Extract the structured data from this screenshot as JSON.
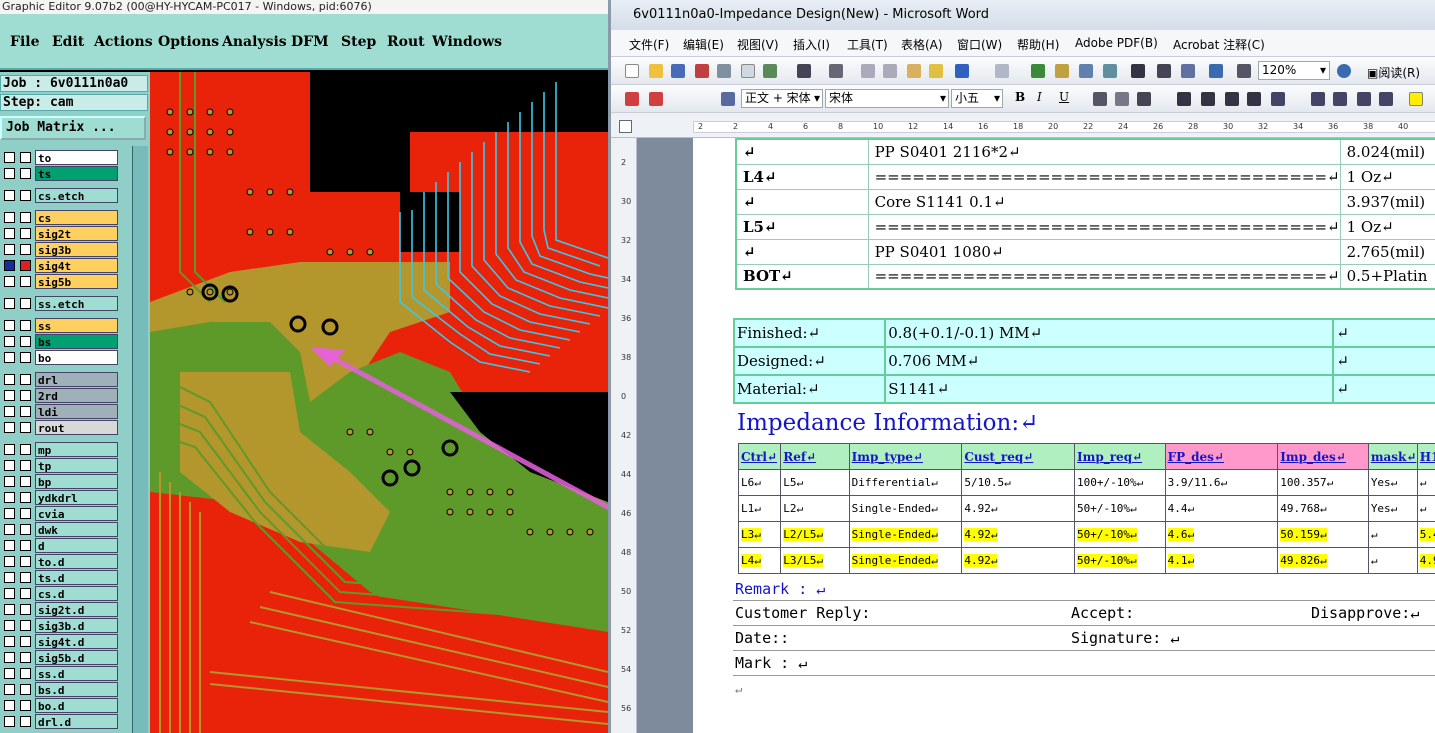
{
  "ge": {
    "title": "Graphic Editor 9.07b2 (00@HY-HYCAM-PC017 - Windows, pid:6076)",
    "menu": [
      "File",
      "Edit",
      "Actions",
      "Options",
      "Analysis",
      "DFM",
      "Step",
      "Rout",
      "Windows"
    ],
    "job": "Job : 6v0111n0a0",
    "step": "Step: cam",
    "job_matrix": "Job Matrix ...",
    "layers": [
      {
        "name": "to",
        "color": "#ffffff"
      },
      {
        "name": "ts",
        "color": "#00a070"
      },
      {
        "name": "cs.etch",
        "color": "#9fdcd2"
      },
      {
        "name": "cs",
        "color": "#ffd060"
      },
      {
        "name": "sig2t",
        "color": "#ffd060"
      },
      {
        "name": "sig3b",
        "color": "#ffd060"
      },
      {
        "name": "sig4t",
        "color": "#ffd060"
      },
      {
        "name": "sig5b",
        "color": "#ffd060"
      },
      {
        "name": "ss.etch",
        "color": "#9fdcd2"
      },
      {
        "name": "ss",
        "color": "#ffd060"
      },
      {
        "name": "bs",
        "color": "#00a070"
      },
      {
        "name": "bo",
        "color": "#ffffff"
      },
      {
        "name": "drl",
        "color": "#a0b0b8"
      },
      {
        "name": "2rd",
        "color": "#a0b0b8"
      },
      {
        "name": "ldi",
        "color": "#a0b0b8"
      },
      {
        "name": "rout",
        "color": "#d8d8d8"
      },
      {
        "name": "mp",
        "color": "#9fdcd2"
      },
      {
        "name": "tp",
        "color": "#9fdcd2"
      },
      {
        "name": "bp",
        "color": "#9fdcd2"
      },
      {
        "name": "ydkdrl",
        "color": "#9fdcd2"
      },
      {
        "name": "cvia",
        "color": "#9fdcd2"
      },
      {
        "name": "dwk",
        "color": "#9fdcd2"
      },
      {
        "name": "d",
        "color": "#9fdcd2"
      },
      {
        "name": "to.d",
        "color": "#9fdcd2"
      },
      {
        "name": "ts.d",
        "color": "#9fdcd2"
      },
      {
        "name": "cs.d",
        "color": "#9fdcd2"
      },
      {
        "name": "sig2t.d",
        "color": "#9fdcd2"
      },
      {
        "name": "sig3b.d",
        "color": "#9fdcd2"
      },
      {
        "name": "sig4t.d",
        "color": "#9fdcd2"
      },
      {
        "name": "sig5b.d",
        "color": "#9fdcd2"
      },
      {
        "name": "ss.d",
        "color": "#9fdcd2"
      },
      {
        "name": "bs.d",
        "color": "#9fdcd2"
      },
      {
        "name": "bo.d",
        "color": "#9fdcd2"
      },
      {
        "name": "drl.d",
        "color": "#9fdcd2"
      }
    ]
  },
  "word": {
    "title": "6v0111n0a0-Impedance Design(New) - Microsoft Word",
    "menu": [
      "文件(F)",
      "编辑(E)",
      "视图(V)",
      "插入(I)",
      "工具(T)",
      "表格(A)",
      "窗口(W)",
      "帮助(H)",
      "Adobe PDF(B)",
      "Acrobat 注释(C)"
    ],
    "zoom": "120%",
    "reading": "阅读(R)",
    "style": "正文 + 宋体",
    "font": "宋体",
    "size": "小五",
    "stackup": [
      [
        "↵",
        "PP      S0401     2116*2↵",
        "8.024(mil)"
      ],
      [
        "L4↵",
        "====================================↵",
        "1 Oz↵"
      ],
      [
        "↵",
        "Core      S1141     0.1↵",
        "3.937(mil)"
      ],
      [
        "L5↵",
        "====================================↵",
        "1 Oz↵"
      ],
      [
        "↵",
        "PP      S0401     1080↵",
        "2.765(mil)"
      ],
      [
        "BOT↵",
        "====================================↵",
        "0.5+Platin"
      ]
    ],
    "spec": [
      [
        "Finished:↵",
        "0.8(+0.1/-0.1) MM↵",
        "↵"
      ],
      [
        "Designed:↵",
        "0.706 MM↵",
        "↵"
      ],
      [
        "Material:↵",
        "S1141↵",
        "↵"
      ]
    ],
    "imp_title": "Impedance Information:↵",
    "imp_headers": [
      "Ctrl↵",
      "Ref↵",
      "Imp_type↵",
      "Cust_req↵",
      "Imp_req↵",
      "FP_des↵",
      "Imp_des↵",
      "mask↵",
      "H1↵"
    ],
    "imp_rows": [
      {
        "cells": [
          "L6↵",
          "L5↵",
          "Differential↵",
          "5/10.5↵",
          "100+/-10%↵",
          "3.9/11.6↵",
          "100.357↵",
          "Yes↵",
          "↵"
        ],
        "hl": false
      },
      {
        "cells": [
          "L1↵",
          "L2↵",
          "Single-Ended↵",
          "4.92↵",
          "50+/-10%↵",
          "4.4↵",
          "49.768↵",
          "Yes↵",
          "↵"
        ],
        "hl": false
      },
      {
        "cells": [
          "L3↵",
          "L2/L5↵",
          "Single-Ended↵",
          "4.92↵",
          "50+/-10%↵",
          "4.6↵",
          "50.159↵",
          "↵",
          "5.4"
        ],
        "hl": true
      },
      {
        "cells": [
          "L4↵",
          "L3/L5↵",
          "Single-Ended↵",
          "4.92↵",
          "50+/-10%↵",
          "4.1↵",
          "49.826↵",
          "↵",
          "4.9"
        ],
        "hl": true
      }
    ],
    "remark": "Remark : ↵",
    "customer_reply": "Customer Reply:",
    "accept": "Accept:",
    "disapprove": "Disapprove:↵",
    "date": "Date::",
    "signature": "Signature: ↵",
    "mark": "Mark : ↵",
    "end_mark": "↵",
    "ruler_marks": [
      "2",
      "2",
      "4",
      "6",
      "8",
      "10",
      "12",
      "14",
      "16",
      "18",
      "20",
      "22",
      "24",
      "26",
      "28",
      "30",
      "32",
      "34",
      "36",
      "38",
      "40"
    ],
    "vruler_marks": [
      "2",
      "30",
      "32",
      "34",
      "36",
      "38",
      "0",
      "42",
      "44",
      "46",
      "48",
      "50",
      "52",
      "54",
      "56"
    ]
  }
}
